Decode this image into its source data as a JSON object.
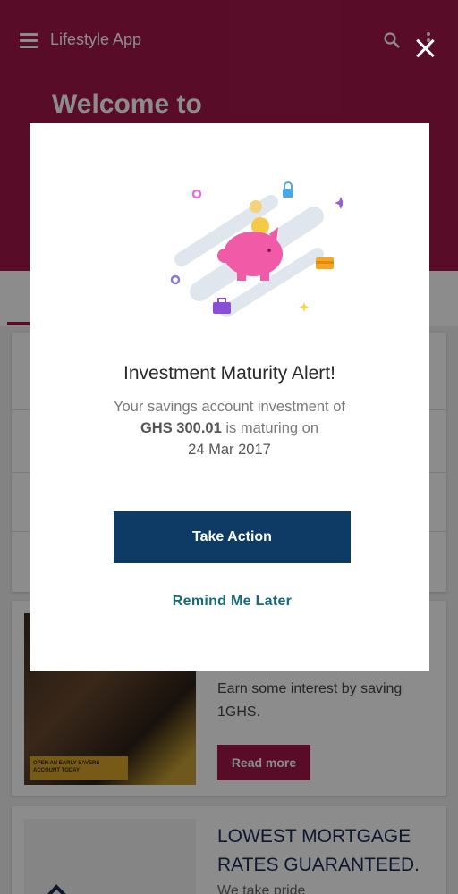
{
  "app": {
    "title": "Lifestyle App",
    "welcome": "Welcome to",
    "accent_color": "#a3174a",
    "icons": {
      "menu": "menu-icon",
      "search": "search-icon",
      "more": "more-vert-icon"
    }
  },
  "promos": [
    {
      "photo_banner": "OPEN AN EARLY SAVERS ACCOUNT TODAY",
      "text": "Earn some interest by saving 1GHS.",
      "button_label": "Read more"
    },
    {
      "title": "LOWEST MORTGAGE RATES GUARANTEED.",
      "subtitle": "We take pride"
    }
  ],
  "modal": {
    "close_icon": "close-icon",
    "title": "Investment Maturity Alert!",
    "body_prefix": "Your savings account investment of",
    "amount": "GHS 300.01",
    "body_middle": "is maturing on",
    "date": "24 Mar 2017",
    "primary_button": "Take Action",
    "secondary_button": "Remind Me Later",
    "primary_color": "#0e3a66",
    "link_color": "#166a7a",
    "illustration": "piggy-bank-illustration"
  }
}
